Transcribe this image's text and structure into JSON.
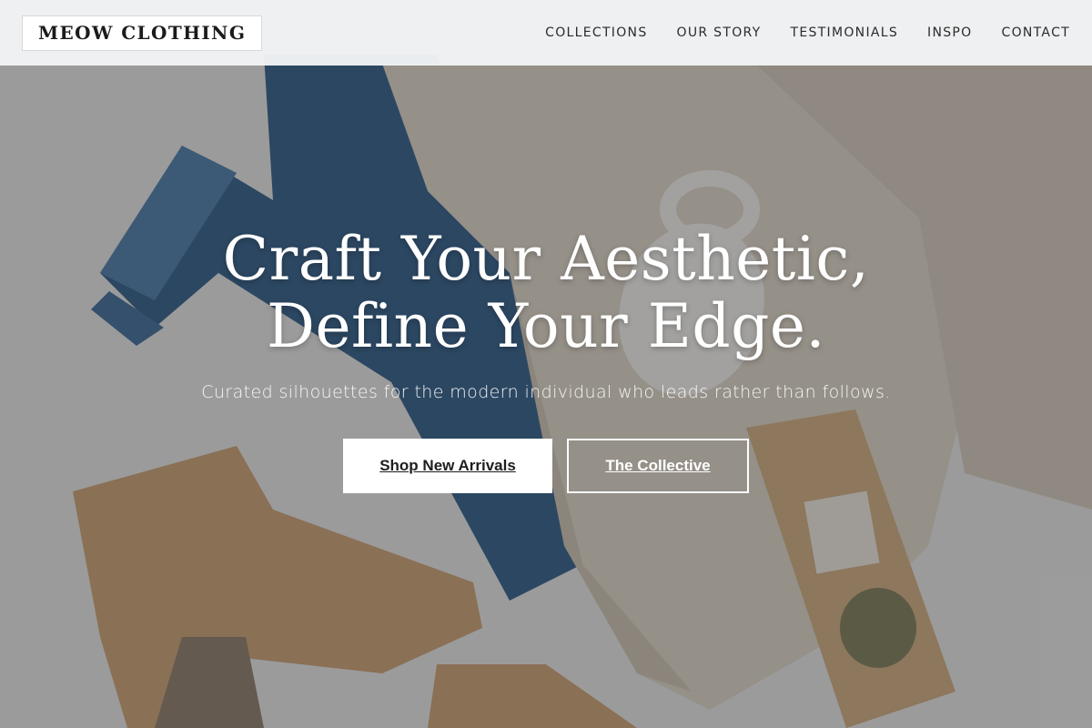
{
  "header": {
    "logo_text": "MEOW CLOTHING",
    "nav": [
      {
        "label": "COLLECTIONS"
      },
      {
        "label": "OUR STORY"
      },
      {
        "label": "TESTIMONIALS"
      },
      {
        "label": "INSPO"
      },
      {
        "label": "CONTACT"
      }
    ]
  },
  "hero": {
    "headline_line1": "Craft Your Aesthetic,",
    "headline_line2": "Define Your Edge.",
    "subtitle": "Curated silhouettes for the modern individual who leads rather than follows.",
    "primary_cta": "Shop New Arrivals",
    "secondary_cta": "The Collective",
    "photo_items": [
      "denim-jeans",
      "knit-sweater",
      "coffee-mug",
      "suede-ankle-boots",
      "tea-bag"
    ]
  },
  "colors": {
    "header_bg": "#f3f4f5",
    "text_dark": "#1b1b1b",
    "cta_primary_bg": "#ffffff",
    "hero_overlay": "rgba(40,40,40,0.38)"
  }
}
